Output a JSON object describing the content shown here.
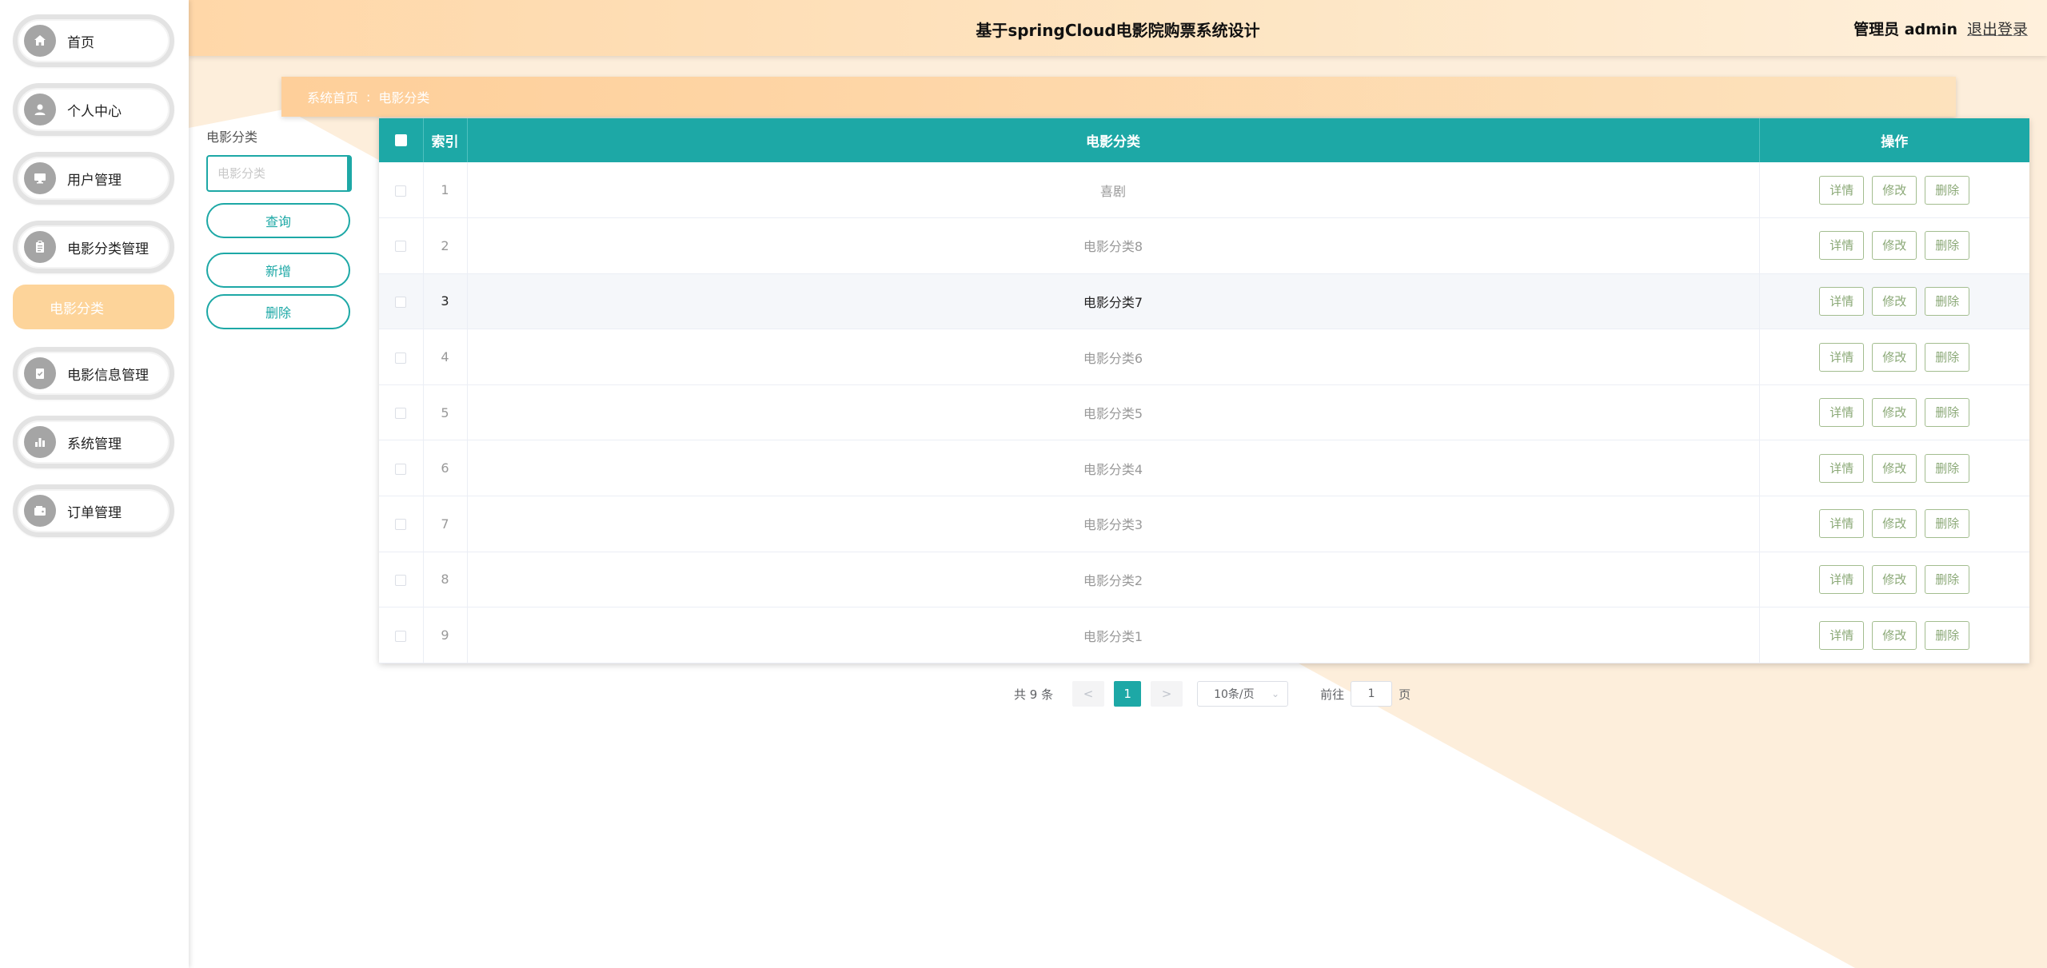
{
  "colors": {
    "accent": "#1da8a6",
    "header_start": "#ffd7a8",
    "submenu_active": "#fdd49a",
    "op_button": "#8aa876",
    "bg_shape": "#fdeedb"
  },
  "header": {
    "title": "基于springCloud电影院购票系统设计",
    "user": "管理员 admin",
    "logout": "退出登录"
  },
  "sidebar": {
    "items": [
      {
        "label": "首页",
        "icon": "home-icon"
      },
      {
        "label": "个人中心",
        "icon": "user-icon"
      },
      {
        "label": "用户管理",
        "icon": "monitor-icon"
      },
      {
        "label": "电影分类管理",
        "icon": "clipboard-icon"
      },
      {
        "label": "电影信息管理",
        "icon": "checklist-icon"
      },
      {
        "label": "系统管理",
        "icon": "bar-chart-icon"
      },
      {
        "label": "订单管理",
        "icon": "wallet-icon"
      }
    ],
    "submenu": {
      "label": "电影分类"
    }
  },
  "breadcrumb": {
    "home": "系统首页",
    "separator": ":",
    "current": "电影分类"
  },
  "search": {
    "label": "电影分类",
    "placeholder": "电影分类",
    "query_label": "查询",
    "add_label": "新增",
    "delete_label": "删除"
  },
  "table": {
    "headers": {
      "index": "索引",
      "category": "电影分类",
      "actions": "操作"
    },
    "rows": [
      {
        "index": "1",
        "category": "喜剧"
      },
      {
        "index": "2",
        "category": "电影分类8"
      },
      {
        "index": "3",
        "category": "电影分类7"
      },
      {
        "index": "4",
        "category": "电影分类6"
      },
      {
        "index": "5",
        "category": "电影分类5"
      },
      {
        "index": "6",
        "category": "电影分类4"
      },
      {
        "index": "7",
        "category": "电影分类3"
      },
      {
        "index": "8",
        "category": "电影分类2"
      },
      {
        "index": "9",
        "category": "电影分类1"
      }
    ],
    "highlighted_row": 2,
    "action_labels": {
      "detail": "详情",
      "edit": "修改",
      "delete": "删除"
    }
  },
  "pagination": {
    "total": "共 9 条",
    "prev": "<",
    "current_page": "1",
    "next": ">",
    "page_size": "10条/页",
    "goto_prefix": "前往",
    "goto_value": "1",
    "goto_suffix": "页"
  }
}
